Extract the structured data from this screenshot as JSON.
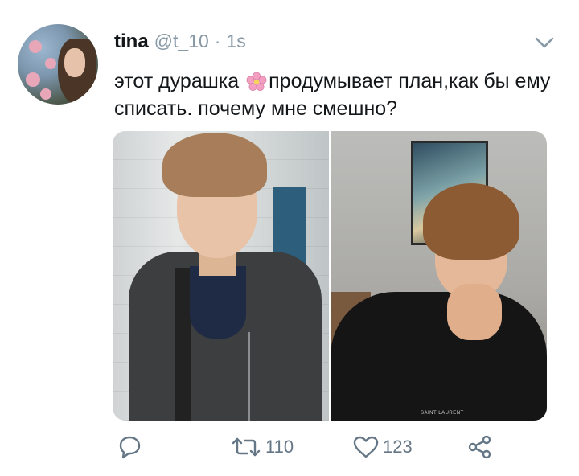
{
  "tweet": {
    "display_name": "tina",
    "handle": "@t_10",
    "separator": "·",
    "time": "1s",
    "text_part1": "этот дурашка ",
    "emoji": "cherry-blossom-emoji",
    "text_part2": "продумывает план,как бы ему списать. почему мне смешно?"
  },
  "media": {
    "photo_left": {
      "logo_text": ""
    },
    "photo_right": {
      "logo_text": "SAINT LAURENT"
    }
  },
  "actions": {
    "reply": {
      "icon": "reply-icon",
      "count": ""
    },
    "retweet": {
      "icon": "retweet-icon",
      "count": "110"
    },
    "like": {
      "icon": "heart-icon",
      "count": "123"
    },
    "share": {
      "icon": "share-icon",
      "count": ""
    }
  },
  "colors": {
    "text": "#14171a",
    "secondary": "#8899a6",
    "icon": "#657786",
    "emoji": "#f29fc2"
  }
}
